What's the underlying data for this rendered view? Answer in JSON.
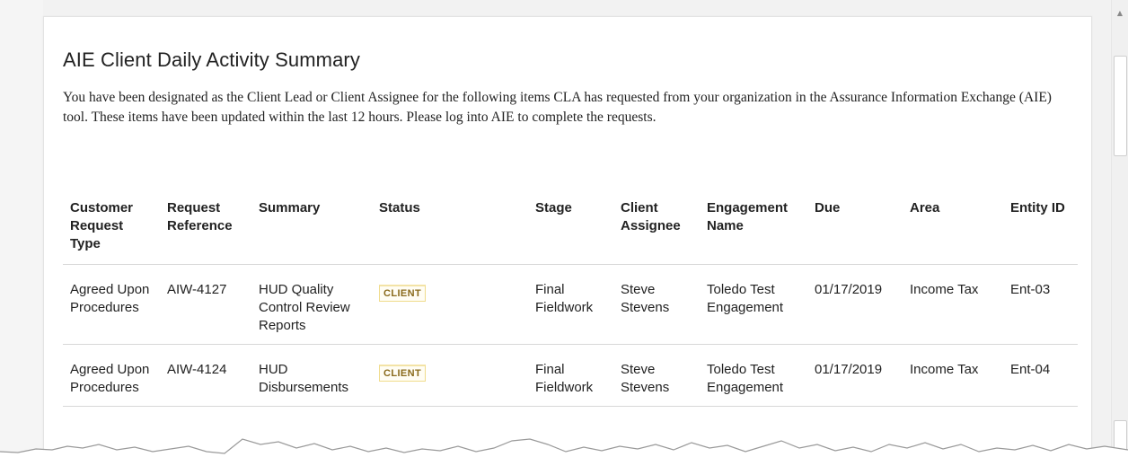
{
  "email": {
    "title": "AIE Client Daily Activity Summary",
    "intro": "You have been designated as the Client Lead or Client Assignee for the following items CLA has requested from your organization in the Assurance Information Exchange (AIE) tool. These items have been updated within the last 12 hours. Please log into AIE to complete the requests."
  },
  "table": {
    "headers": [
      "Customer Request Type",
      "Request Reference",
      "Summary",
      "Status",
      "Stage",
      "Client Assignee",
      "Engagement Name",
      "Due",
      "Area",
      "Entity ID"
    ],
    "rows": [
      {
        "type": "Agreed Upon Procedures",
        "reference": "AIW-4127",
        "summary": "HUD Quality Control Review Reports",
        "status": "CLIENT",
        "stage": "Final Fieldwork",
        "assignee": "Steve Stevens",
        "engagement": "Toledo Test Engagement",
        "due": "01/17/2019",
        "area": "Income Tax",
        "entity": "Ent-03"
      },
      {
        "type": "Agreed Upon Procedures",
        "reference": "AIW-4124",
        "summary": "HUD Disbursements",
        "status": "CLIENT",
        "stage": "Final Fieldwork",
        "assignee": "Steve Stevens",
        "engagement": "Toledo Test Engagement",
        "due": "01/17/2019",
        "area": "Income Tax",
        "entity": "Ent-04"
      }
    ]
  },
  "colors": {
    "badge_text": "#8a6a1c",
    "badge_border": "#f0dc8c",
    "divider": "#d8d8d8"
  },
  "icons": {
    "scroll_up": "triangle-up-icon"
  }
}
